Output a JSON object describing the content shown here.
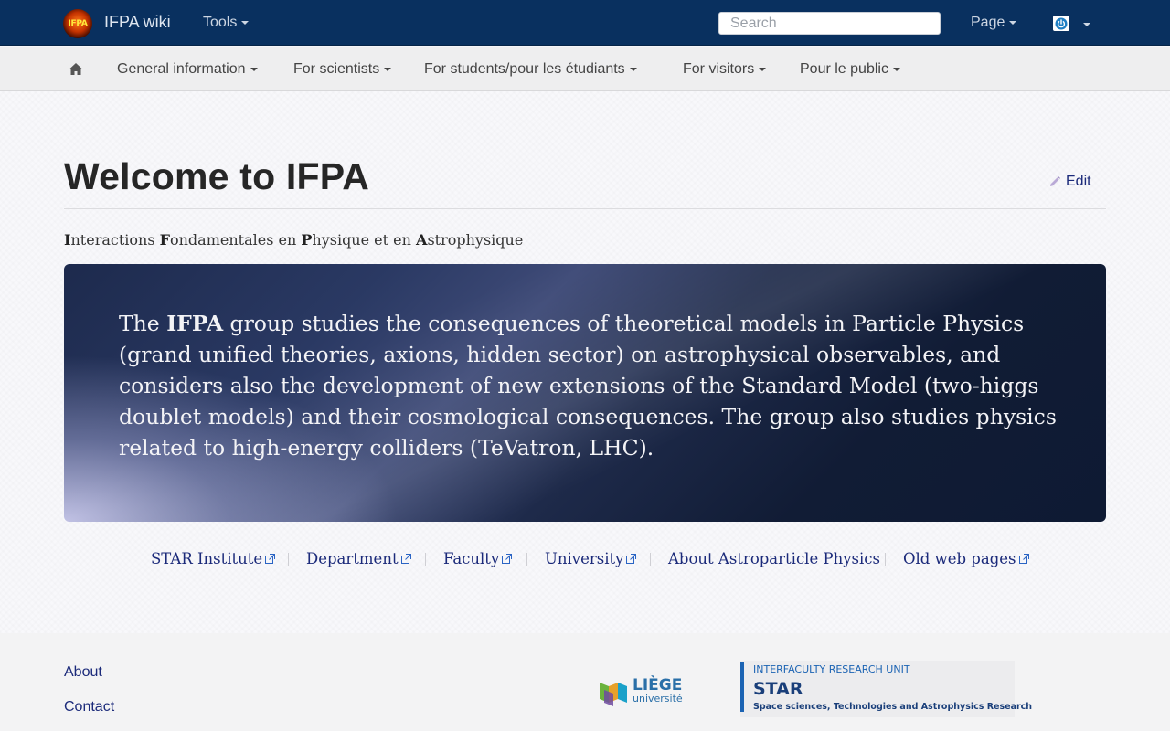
{
  "topbar": {
    "brand": "IFPA wiki",
    "brand_logo_text": "IFPA",
    "tools_label": "Tools",
    "search_placeholder": "Search",
    "page_label": "Page"
  },
  "subnav": {
    "items": [
      {
        "label": "General information"
      },
      {
        "label": "For scientists"
      },
      {
        "label": "For students/pour les étudiants"
      },
      {
        "label": "For visitors"
      },
      {
        "label": "Pour le public"
      }
    ]
  },
  "main": {
    "title": "Welcome to IFPA",
    "edit_label": "Edit",
    "subtitle_parts": [
      {
        "initial": "I",
        "rest": "nteractions "
      },
      {
        "initial": "F",
        "rest": "ondamentales en "
      },
      {
        "initial": "P",
        "rest": "hysique et en "
      },
      {
        "initial": "A",
        "rest": "strophysique"
      }
    ],
    "hero": {
      "lead": "The ",
      "bold": "IFPA",
      "body": " group studies the consequences of theoretical models in Particle Physics (grand unified theories, axions, hidden sector) on astrophysical observables, and considers also the development of new extensions of the Standard Model (two-higgs doublet models) and their cosmological consequences. The group also studies physics related to high-energy colliders (TeVatron, LHC)."
    },
    "links": [
      {
        "label": "STAR Institute",
        "external": true
      },
      {
        "label": "Department",
        "external": true
      },
      {
        "label": "Faculty",
        "external": true
      },
      {
        "label": "University",
        "external": true
      },
      {
        "label": "About Astroparticle Physics",
        "external": false
      },
      {
        "label": "Old web pages",
        "external": true
      }
    ]
  },
  "footer": {
    "about": "About",
    "contact": "Contact",
    "uliege_top": "LIÈGE",
    "uliege_bottom": "université",
    "star_top": "INTERFACULTY RESEARCH UNIT",
    "star_name": "STAR",
    "star_sub": "Space sciences, Technologies and Astrophysics Research"
  },
  "colors": {
    "topbar_bg": "#09305f",
    "link": "#1b2a7a",
    "hero_dark": "#111c35"
  }
}
